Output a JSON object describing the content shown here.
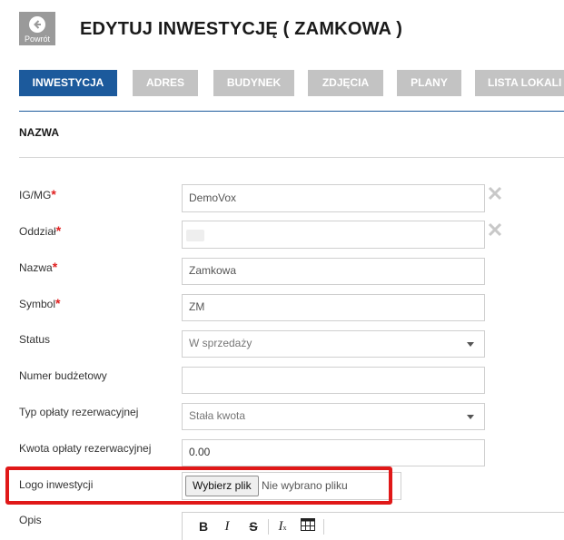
{
  "header": {
    "back_label": "Powrót",
    "title": "EDYTUJ INWESTYCJĘ ( ZAMKOWA )"
  },
  "tabs": [
    {
      "label": "INWESTYCJA",
      "active": true
    },
    {
      "label": "ADRES",
      "active": false
    },
    {
      "label": "BUDYNEK",
      "active": false
    },
    {
      "label": "ZDJĘCIA",
      "active": false
    },
    {
      "label": "PLANY",
      "active": false
    },
    {
      "label": "LISTA LOKALI",
      "active": false
    }
  ],
  "section": {
    "title": "NAZWA"
  },
  "form": {
    "igmg": {
      "label": "IG/MG",
      "required": "*",
      "value": "DemoVox"
    },
    "oddzial": {
      "label": "Oddział",
      "required": "*",
      "value": ""
    },
    "nazwa": {
      "label": "Nazwa",
      "required": "*",
      "value": "Zamkowa"
    },
    "symbol": {
      "label": "Symbol",
      "required": "*",
      "value": "ZM"
    },
    "status": {
      "label": "Status",
      "value": "W sprzedaży"
    },
    "numer_budzetowy": {
      "label": "Numer budżetowy",
      "value": ""
    },
    "typ_oplaty": {
      "label": "Typ opłaty rezerwacyjnej",
      "value": "Stała kwota"
    },
    "kwota_oplaty": {
      "label": "Kwota opłaty rezerwacyjnej",
      "value": "0.00"
    },
    "logo": {
      "label": "Logo inwestycji",
      "button": "Wybierz plik",
      "status": "Nie wybrano pliku"
    },
    "opis": {
      "label": "Opis"
    }
  },
  "colors": {
    "accent": "#1c5a9c",
    "tab_inactive": "#c3c3c3",
    "required": "#e02020",
    "highlight": "#e01818"
  },
  "icons": [
    "arrow-left-icon",
    "clear-x-icon",
    "caret-down-icon",
    "bold-icon",
    "italic-icon",
    "strikethrough-icon",
    "clear-format-icon",
    "table-icon"
  ]
}
